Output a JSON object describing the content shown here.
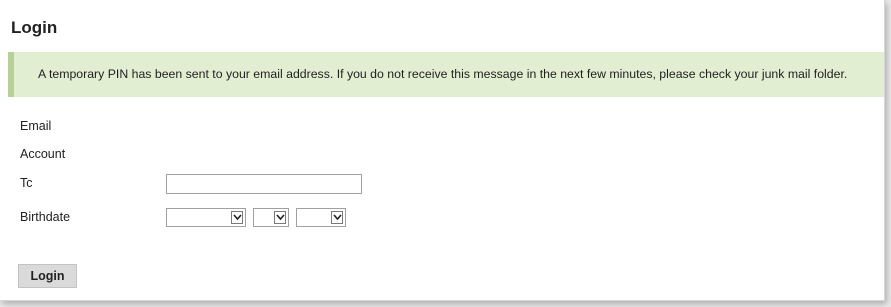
{
  "page": {
    "title": "Login"
  },
  "notice": {
    "message": "A temporary PIN has been sent to your email address. If you do not receive this message in the next few minutes, please check your junk mail folder."
  },
  "form": {
    "email_label": "Email",
    "account_label": "Account",
    "pin_label": "Tc",
    "pin_value": "",
    "birthdate_label": "Birthdate",
    "month_value": "",
    "day_value": "",
    "year_value": "",
    "submit_label": "Login"
  },
  "colors": {
    "notice_background": "#e2eed2",
    "notice_accent": "#b7cf98",
    "button_background": "#dadada"
  },
  "icons": {
    "select_arrow": "chevron-down-icon"
  }
}
